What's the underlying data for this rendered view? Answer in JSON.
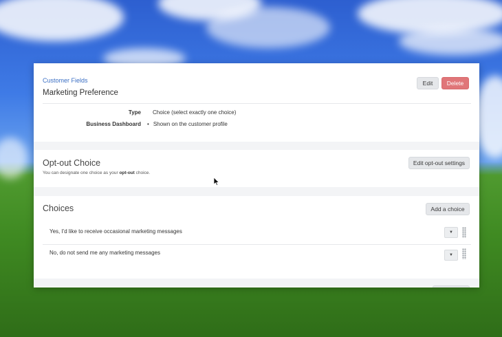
{
  "header": {
    "breadcrumb": "Customer Fields",
    "title": "Marketing Preference",
    "edit_label": "Edit",
    "delete_label": "Delete",
    "properties": [
      {
        "label": "Type",
        "value": "Choice (select exactly one choice)"
      },
      {
        "label": "Business Dashboard",
        "value": "Shown on the customer profile"
      }
    ]
  },
  "opt_out": {
    "title": "Opt-out Choice",
    "helper_prefix": "You can designate one choice as your ",
    "helper_bold": "opt-out",
    "helper_suffix": " choice.",
    "edit_settings_label": "Edit opt-out settings"
  },
  "choices": {
    "title": "Choices",
    "add_label": "Add a choice",
    "items": [
      {
        "label": "Yes, I'd like to receive occasional marketing messages"
      },
      {
        "label": "No, do not send me any marketing messages"
      }
    ]
  },
  "icons": {
    "dropdown": "caret-down-icon",
    "drag": "drag-handle-icon",
    "cursor": "mouse-pointer-icon"
  },
  "colors": {
    "link": "#3b6fc4",
    "danger": "#e07679",
    "panel_bg": "#f3f4f6"
  }
}
